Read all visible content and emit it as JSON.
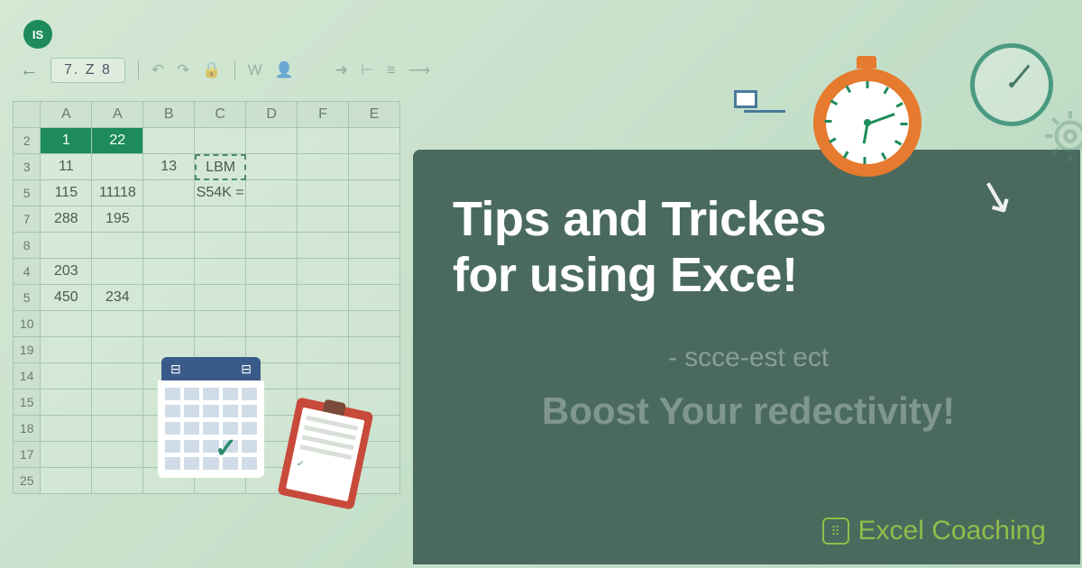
{
  "badge": "IS",
  "toolbar": {
    "namebox": "7. Z 8",
    "icons": [
      "↶",
      "↷",
      "🔒",
      "W",
      "👤",
      "➜",
      "⊢",
      "≡",
      "⟶"
    ]
  },
  "grid": {
    "colheads": [
      "",
      "A",
      "A",
      "B",
      "C",
      "D",
      "F",
      "E"
    ],
    "rows": [
      {
        "h": "2",
        "cells": [
          "1",
          "22",
          "",
          "",
          "",
          "",
          ""
        ],
        "selcols": [
          0,
          1
        ]
      },
      {
        "h": "3",
        "cells": [
          "11",
          "",
          "13",
          "LBM",
          "",
          "",
          ""
        ],
        "outline": 3
      },
      {
        "h": "5",
        "cells": [
          "115",
          "11118",
          "",
          "S54K =",
          "",
          "",
          ""
        ]
      },
      {
        "h": "7",
        "cells": [
          "288",
          "195",
          "",
          "",
          "",
          "",
          ""
        ]
      },
      {
        "h": "8",
        "cells": [
          "",
          "",
          "",
          "",
          "",
          "",
          ""
        ]
      },
      {
        "h": "4",
        "cells": [
          "203",
          "",
          "",
          "",
          "",
          "",
          ""
        ]
      },
      {
        "h": "5",
        "cells": [
          "450",
          "234",
          "",
          "",
          "",
          "",
          ""
        ]
      },
      {
        "h": "10",
        "cells": [
          "",
          "",
          "",
          "",
          "",
          "",
          ""
        ]
      },
      {
        "h": "19",
        "cells": [
          "",
          "",
          "",
          "",
          "",
          "",
          ""
        ]
      },
      {
        "h": "14",
        "cells": [
          "",
          "",
          "",
          "",
          "",
          "",
          ""
        ]
      },
      {
        "h": "15",
        "cells": [
          "",
          "",
          "",
          "",
          "",
          "",
          ""
        ]
      },
      {
        "h": "18",
        "cells": [
          "",
          "",
          "",
          "",
          "",
          "",
          ""
        ]
      },
      {
        "h": "17",
        "cells": [
          "",
          "",
          "",
          "",
          "",
          "",
          ""
        ]
      },
      {
        "h": "25",
        "cells": [
          "",
          "",
          "",
          "",
          "",
          "",
          ""
        ]
      }
    ]
  },
  "promo": {
    "title_l1": "Tips and Trickes",
    "title_l2": "for using Exce!",
    "sub1": "- scce-est ect",
    "sub2": "Boost Your redectivity!"
  },
  "calendar": {
    "left": "⊟",
    "right": "⊟"
  },
  "brand": {
    "text": "Excel Coaching",
    "glyph": "⠿"
  }
}
